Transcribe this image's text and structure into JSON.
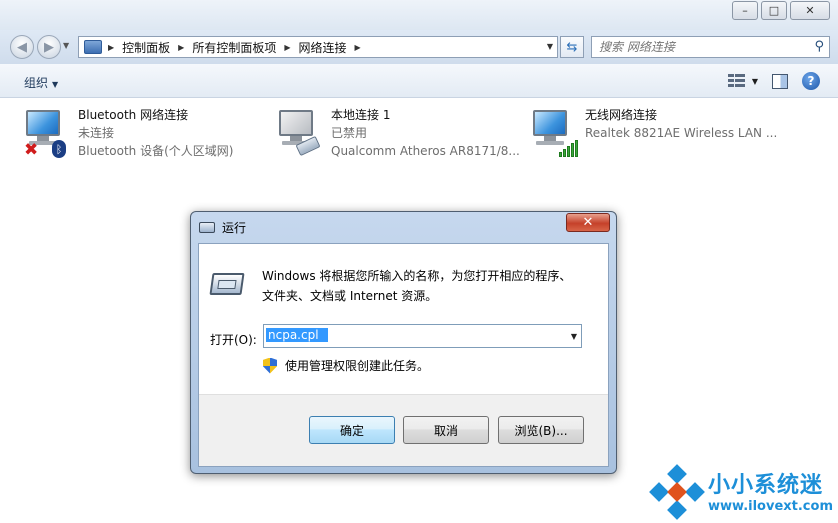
{
  "window": {
    "caption_min": "–",
    "caption_max": "□",
    "caption_close": "✕"
  },
  "address_bar": {
    "back_glyph": "◀",
    "forward_glyph": "▶",
    "breadcrumb": [
      "控制面板",
      "所有控制面板项",
      "网络连接"
    ],
    "search_placeholder": "搜索 网络连接",
    "search_icon": "magnifier-icon",
    "refresh_icon": "refresh-icon"
  },
  "toolbar": {
    "organize_label": "组织",
    "help_label": "?"
  },
  "connections": [
    {
      "name": "Bluetooth 网络连接",
      "status": "未连接",
      "device": "Bluetooth 设备(个人区域网)",
      "icon": "bluetooth-disconnected"
    },
    {
      "name": "本地连接 1",
      "status": "已禁用",
      "device": "Qualcomm Atheros AR8171/8...",
      "icon": "ethernet-disabled"
    },
    {
      "name": "无线网络连接",
      "status": "",
      "device": "Realtek 8821AE Wireless LAN ...",
      "icon": "wireless-signal"
    }
  ],
  "run_dialog": {
    "title": "运行",
    "close_glyph": "✕",
    "description_line1": "Windows 将根据您所输入的名称，为您打开相应的程序、",
    "description_line2": "文件夹、文档或 Internet 资源。",
    "open_label": "打开(O):",
    "open_value": "ncpa.cpl",
    "admin_note": "使用管理权限创建此任务。",
    "ok_label": "确定",
    "cancel_label": "取消",
    "browse_label": "浏览(B)..."
  },
  "watermark": {
    "name": "小小系统迷",
    "url": "www.ilovext.com",
    "color": "#1d8fd8"
  }
}
